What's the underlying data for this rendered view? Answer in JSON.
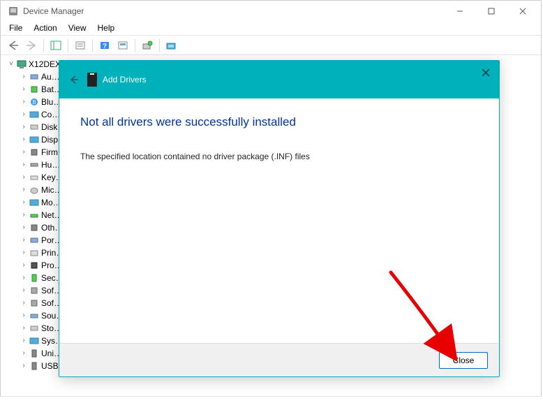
{
  "window": {
    "title": "Device Manager"
  },
  "menu": {
    "file": "File",
    "action": "Action",
    "view": "View",
    "help": "Help"
  },
  "tree": {
    "root": "X12DEX",
    "items": [
      "Au…",
      "Bat…",
      "Blu…",
      "Co…",
      "Disk…",
      "Disp…",
      "Firm…",
      "Hu…",
      "Key…",
      "Mic…",
      "Mo…",
      "Net…",
      "Oth…",
      "Por…",
      "Prin…",
      "Pro…",
      "Sec…",
      "Sof…",
      "Sof…",
      "Sou…",
      "Sto…",
      "Sys…",
      "Uni…",
      "USB…"
    ]
  },
  "dialog": {
    "title": "Add Drivers",
    "heading": "Not all drivers were successfully installed",
    "message": "The specified location contained no driver package (.INF) files",
    "close": "Close"
  }
}
